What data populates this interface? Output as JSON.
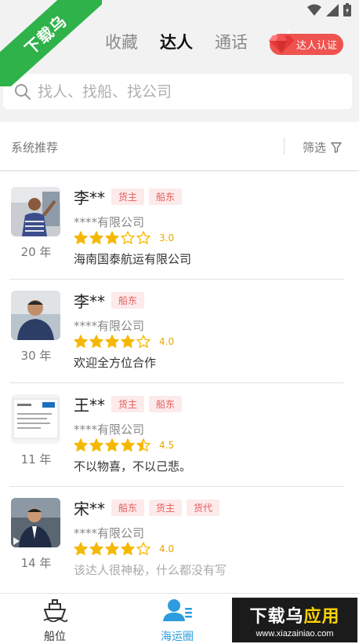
{
  "watermark": {
    "corner_text": "下载乌",
    "brand_prefix": "下载乌",
    "brand_suffix": "应用",
    "url": "www.xiazainiao.com"
  },
  "header": {
    "tabs": [
      {
        "label": "收藏",
        "active": false
      },
      {
        "label": "达人",
        "active": true
      },
      {
        "label": "通话",
        "active": false
      }
    ],
    "cert_button": "达人认证",
    "search_placeholder": "找人、找船、找公司"
  },
  "filter_bar": {
    "label": "系统推荐",
    "filter": "筛选"
  },
  "experts": [
    {
      "name": "李**",
      "tags": [
        "货主",
        "船东"
      ],
      "company": "****有限公司",
      "rating": 3.0,
      "score": "3.0",
      "years": "20 年",
      "intro": "海南国泰航运有限公司",
      "muted": false
    },
    {
      "name": "李**",
      "tags": [
        "船东"
      ],
      "company": "****有限公司",
      "rating": 4.0,
      "score": "4.0",
      "years": "30 年",
      "intro": "欢迎全方位合作",
      "muted": false
    },
    {
      "name": "王**",
      "tags": [
        "货主",
        "船东"
      ],
      "company": "****有限公司",
      "rating": 4.5,
      "score": "4.5",
      "years": "11 年",
      "intro": "不以物喜，不以己悲。",
      "muted": false
    },
    {
      "name": "宋**",
      "tags": [
        "船东",
        "货主",
        "货代"
      ],
      "company": "****有限公司",
      "rating": 4.0,
      "score": "4.0",
      "years": "14 年",
      "intro": "该达人很神秘，什么都没有写",
      "muted": true
    }
  ],
  "bottom_nav": [
    {
      "label": "船位",
      "icon": "ship-icon",
      "active": false
    },
    {
      "label": "海运圈",
      "icon": "contacts-icon",
      "active": true
    }
  ],
  "colors": {
    "accent": "#2c9cde",
    "tag_red": "#e35d5d",
    "star": "#f5b800",
    "cert": "#ef5350",
    "watermark_green": "#2fb24a"
  }
}
